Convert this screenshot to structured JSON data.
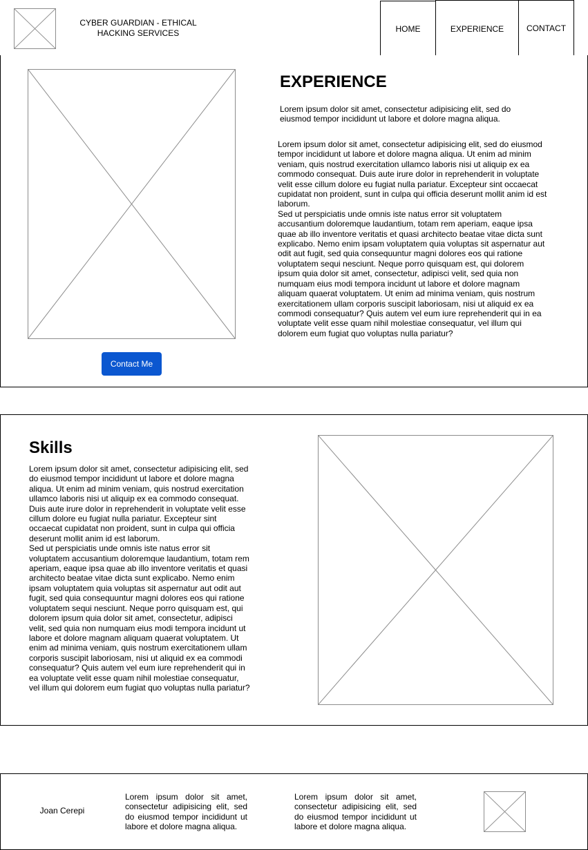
{
  "header": {
    "brand_line1": "CYBER GUARDIAN - ETHICAL",
    "brand_line2": "HACKING SERVICES",
    "nav": {
      "home": "HOME",
      "experience": "EXPERIENCE",
      "contact": "CONTACT"
    }
  },
  "experience": {
    "title": "EXPERIENCE",
    "intro": "Lorem ipsum dolor sit amet, consectetur adipisicing elit, sed do eiusmod tempor incididunt ut labore et dolore magna aliqua.",
    "body_p1": "Lorem ipsum dolor sit amet, consectetur adipisicing elit, sed do eiusmod tempor incididunt ut labore et dolore magna aliqua. Ut enim ad minim veniam, quis nostrud exercitation ullamco laboris nisi ut aliquip ex ea commodo consequat. Duis aute irure dolor in reprehenderit in voluptate velit esse cillum dolore eu fugiat nulla pariatur. Excepteur sint occaecat cupidatat non proident, sunt in culpa qui officia deserunt mollit anim id est laborum.",
    "body_p2": "Sed ut perspiciatis unde omnis iste natus error sit voluptatem accusantium doloremque laudantium, totam rem aperiam, eaque ipsa quae ab illo inventore veritatis et quasi architecto beatae vitae dicta sunt explicabo. Nemo enim ipsam voluptatem quia voluptas sit aspernatur aut odit aut fugit, sed quia consequuntur magni dolores eos qui ratione voluptatem sequi nesciunt. Neque porro quisquam est, qui dolorem ipsum quia dolor sit amet, consectetur, adipisci velit, sed quia non numquam eius modi tempora incidunt ut labore et dolore magnam aliquam quaerat voluptatem. Ut enim ad minima veniam, quis nostrum exercitationem ullam corporis suscipit laboriosam, nisi ut aliquid ex ea commodi consequatur? Quis autem vel eum iure reprehenderit qui in ea voluptate velit esse quam nihil molestiae consequatur, vel illum qui dolorem eum fugiat quo voluptas nulla pariatur?",
    "contact_button": "Contact Me"
  },
  "skills": {
    "title": "Skills",
    "body_p1": "Lorem ipsum dolor sit amet, consectetur adipisicing elit, sed do eiusmod tempor incididunt ut labore et dolore magna aliqua. Ut enim ad minim veniam, quis nostrud exercitation ullamco laboris nisi ut aliquip ex ea commodo consequat. Duis aute irure dolor in reprehenderit in voluptate velit esse cillum dolore eu fugiat nulla pariatur. Excepteur sint occaecat cupidatat non proident, sunt in culpa qui officia deserunt mollit anim id est laborum.",
    "body_p2": "Sed ut perspiciatis unde omnis iste natus error sit voluptatem accusantium doloremque laudantium, totam rem aperiam, eaque ipsa quae ab illo inventore veritatis et quasi architecto beatae vitae dicta sunt explicabo. Nemo enim ipsam voluptatem quia voluptas sit aspernatur aut odit aut fugit, sed quia consequuntur magni dolores eos qui ratione voluptatem sequi nesciunt. Neque porro quisquam est, qui dolorem ipsum quia dolor sit amet, consectetur, adipisci velit, sed quia non numquam eius modi tempora incidunt ut labore et dolore magnam aliquam quaerat voluptatem. Ut enim ad minima veniam, quis nostrum exercitationem ullam corporis suscipit laboriosam, nisi ut aliquid ex ea commodi consequatur? Quis autem vel eum iure reprehenderit qui in ea voluptate velit esse quam nihil molestiae consequatur, vel illum qui dolorem eum fugiat quo voluptas nulla pariatur?"
  },
  "footer": {
    "name": "Joan Cerepi",
    "col1": "Lorem ipsum dolor sit amet, consectetur adipisicing elit, sed do eiusmod tempor incididunt ut labore et dolore magna aliqua.",
    "col2": "Lorem ipsum dolor sit amet, consectetur adipisicing elit, sed do eiusmod tempor incididunt ut labore et dolore magna aliqua."
  },
  "colors": {
    "accent_button": "#0b57d0",
    "placeholder_stroke": "#8c8c8c"
  }
}
